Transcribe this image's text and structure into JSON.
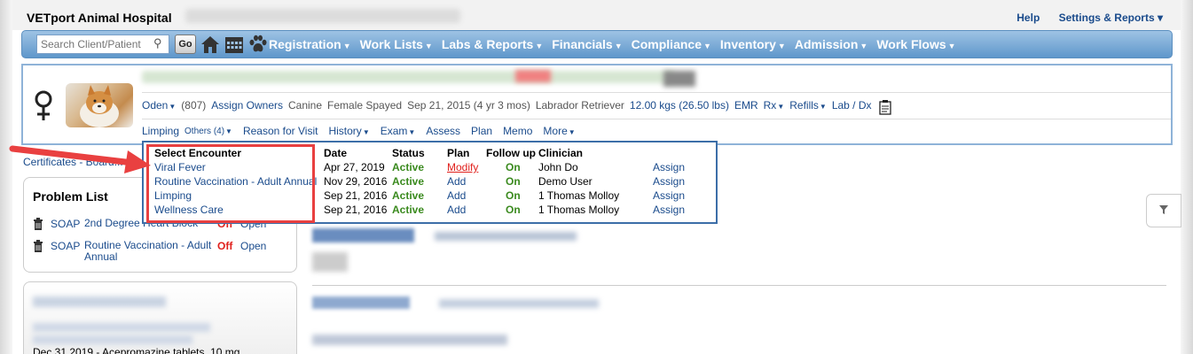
{
  "app": {
    "title": "VETport Animal Hospital"
  },
  "top_links": {
    "help": "Help",
    "settings": "Settings & Reports"
  },
  "nav": {
    "search_placeholder": "Search Client/Patient",
    "go": "Go",
    "menu": [
      "Registration",
      "Work Lists",
      "Labs & Reports",
      "Financials",
      "Compliance",
      "Inventory",
      "Admission",
      "Work Flows"
    ]
  },
  "patient": {
    "name": "Oden",
    "id": "(807)",
    "assign_owners": "Assign Owners",
    "species": "Canine",
    "sex": "Female Spayed",
    "dob": "Sep 21, 2015 (4 yr 3 mos)",
    "breed": "Labrador Retriever",
    "weight": "12.00 kgs (26.50 lbs)",
    "links": [
      "EMR",
      "Rx",
      "Refills",
      "Lab / Dx"
    ]
  },
  "tabs": {
    "limping": "Limping",
    "others": "Others (4)",
    "items": [
      "Reason for Visit",
      "History",
      "Exam",
      "Assess",
      "Plan",
      "Memo",
      "More"
    ]
  },
  "encounter_popup": {
    "headers": [
      "Select Encounter",
      "Date",
      "Status",
      "Plan",
      "Follow up",
      "Clinician"
    ],
    "rows": [
      {
        "name": "Viral Fever",
        "date": "Apr 27, 2019",
        "status": "Active",
        "plan": "Modify",
        "follow": "On",
        "clinician": "John Do",
        "assign": "Assign"
      },
      {
        "name": "Routine Vaccination - Adult Annual",
        "date": "Nov 29, 2016",
        "status": "Active",
        "plan": "Add",
        "follow": "On",
        "clinician": "Demo User",
        "assign": "Assign"
      },
      {
        "name": "Limping",
        "date": "Sep 21, 2016",
        "status": "Active",
        "plan": "Add",
        "follow": "On",
        "clinician": "1 Thomas Molloy",
        "assign": "Assign"
      },
      {
        "name": "Wellness Care",
        "date": "Sep 21, 2016",
        "status": "Active",
        "plan": "Add",
        "follow": "On",
        "clinician": "1 Thomas Molloy",
        "assign": "Assign"
      }
    ]
  },
  "certificates": "Certificates - Board...",
  "problem_list": {
    "title": "Problem List",
    "items": [
      {
        "soap": "SOAP",
        "name": "2nd Degree Heart Block",
        "status": "Off",
        "open": "Open"
      },
      {
        "soap": "SOAP",
        "name": "Routine Vaccination - Adult Annual",
        "status": "Off",
        "open": "Open"
      }
    ]
  },
  "recommended": {
    "last_item": "Dec 31 2019 - Acepromazine tablets, 10 mg"
  },
  "main": {
    "reason_for_visit": "Reason for Visit"
  },
  "colors": {
    "nav_top": "#9ec3e4",
    "nav_bottom": "#5f97cb",
    "link": "#1a4b8c",
    "active": "#3a8a1e",
    "off": "#e0201c",
    "highlight": "#e94040"
  }
}
